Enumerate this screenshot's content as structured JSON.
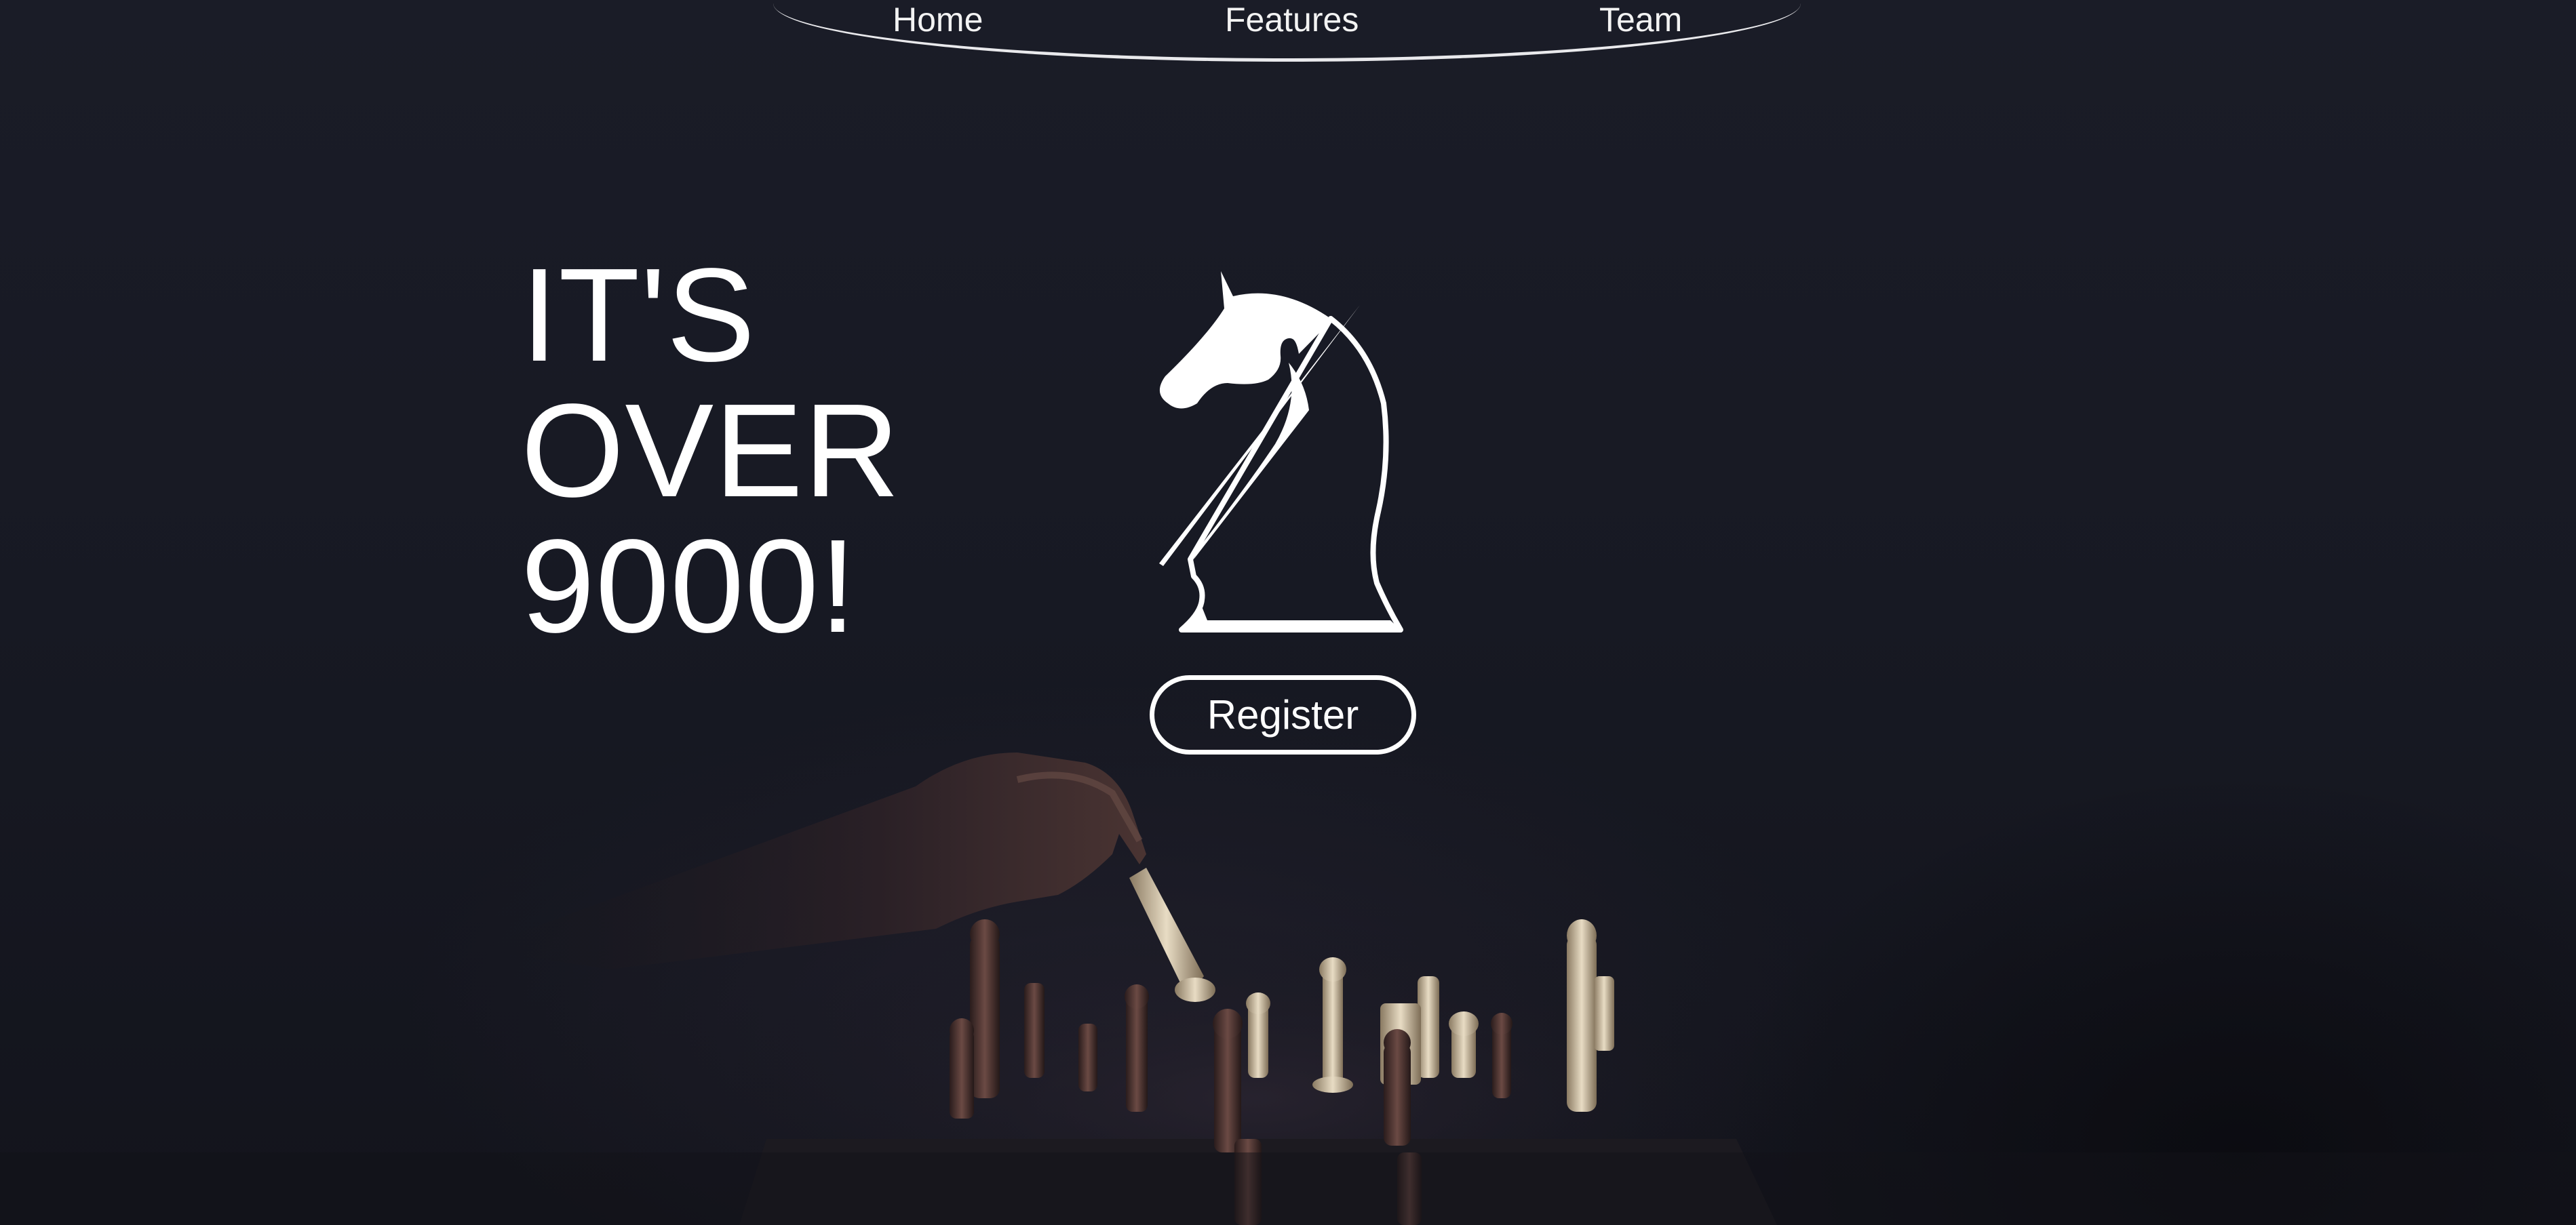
{
  "nav": {
    "items": [
      {
        "label": "Home"
      },
      {
        "label": "Features"
      },
      {
        "label": "Team"
      }
    ]
  },
  "hero": {
    "headline_lines": [
      "IT'S",
      "OVER",
      "9000!"
    ],
    "logo_icon": "chess-knight-icon",
    "register_label": "Register"
  },
  "colors": {
    "background": "#181a24",
    "text": "#ffffff",
    "nav_line": "#e9e9ec"
  }
}
